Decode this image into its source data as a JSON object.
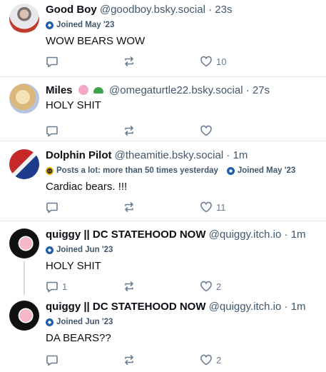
{
  "posts": [
    {
      "name": "Good Boy",
      "handle": "@goodboy.bsky.social",
      "time": "23s",
      "badges": [
        {
          "icon": "verified-dot-icon",
          "text": "Joined May '23"
        }
      ],
      "text": "WOW BEARS WOW",
      "replies": "",
      "reposts": "",
      "likes": "10"
    },
    {
      "name": "Miles",
      "handle": "@omegaturtle22.bsky.social",
      "time": "27s",
      "name_emoji": [
        "pig-emoji-icon",
        "turtle-emoji-icon"
      ],
      "badges": [],
      "text": "HOLY SHIT",
      "replies": "",
      "reposts": "",
      "likes": ""
    },
    {
      "name": "Dolphin Pilot",
      "handle": "@theamitie.bsky.social",
      "time": "1m",
      "badges": [
        {
          "icon": "chatty-icon",
          "text": "Posts a lot: more than 50 times yesterday"
        },
        {
          "icon": "verified-dot-icon",
          "text": "Joined May '23"
        }
      ],
      "text": "Cardiac bears. !!!",
      "replies": "",
      "reposts": "",
      "likes": "11"
    },
    {
      "name": "quiggy || DC STATEHOOD NOW",
      "handle": "@quiggy.itch.io",
      "time": "1m",
      "badges": [
        {
          "icon": "verified-dot-icon",
          "text": "Joined Jun '23"
        }
      ],
      "text": "HOLY SHIT",
      "replies": "1",
      "reposts": "",
      "likes": "2"
    },
    {
      "name": "quiggy || DC STATEHOOD NOW",
      "handle": "@quiggy.itch.io",
      "time": "1m",
      "badges": [
        {
          "icon": "verified-dot-icon",
          "text": "Joined Jun '23"
        }
      ],
      "text": "DA BEARS??",
      "replies": "",
      "reposts": "",
      "likes": "2"
    }
  ],
  "colors": {
    "accent": "#1f5ea8",
    "muted": "#42576c",
    "icon": "#6b7d90",
    "divider": "#e2e7ee"
  },
  "separator": " · "
}
